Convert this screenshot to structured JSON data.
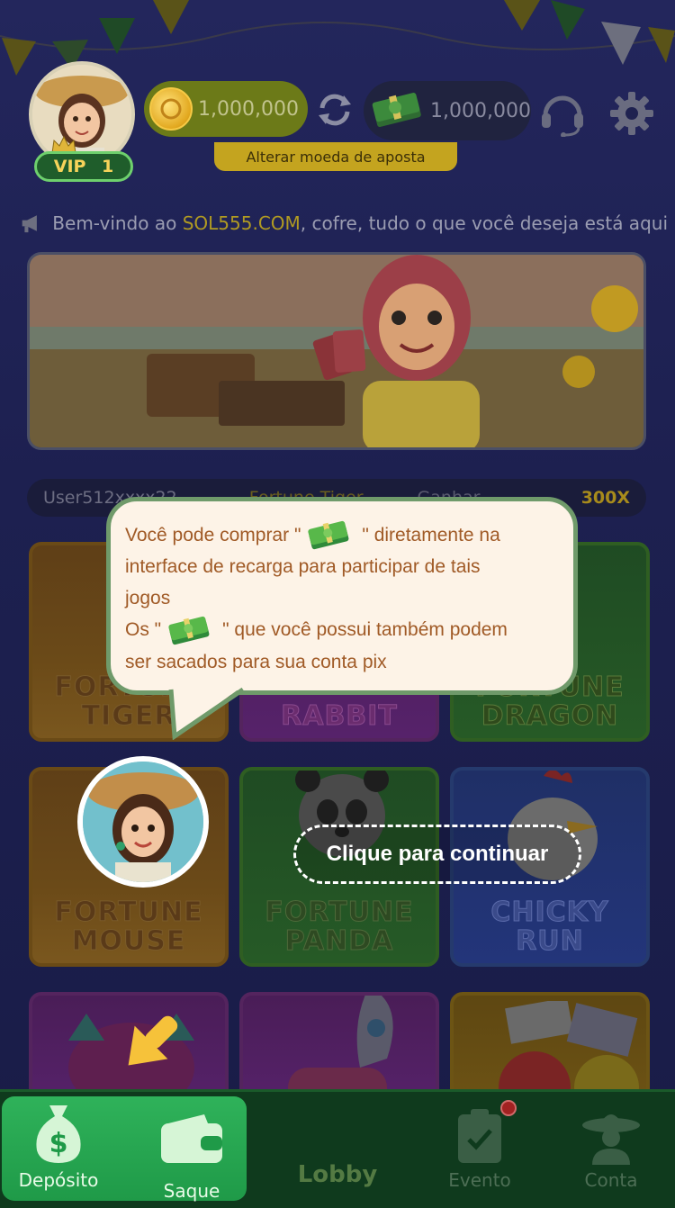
{
  "header": {
    "vip_label": "VIP",
    "vip_level": "1",
    "coin_balance": "1,000,000",
    "cash_balance": "1,000,000",
    "alter_currency_label": "Alterar moeda de aposta"
  },
  "marquee": {
    "prefix": "Bem-vindo ao ",
    "brand": "SOL555.COM",
    "suffix": ", cofre, tudo o que você deseja está aqui"
  },
  "ticker": {
    "user": "User512xxxx22",
    "game": "Fortune Tiger",
    "label": "Ganhar",
    "multiplier": "300X"
  },
  "games": [
    {
      "title_line1": "FORTUNE",
      "title_line2": "TIGER"
    },
    {
      "title_line1": "",
      "title_line2": "RABBIT"
    },
    {
      "title_line1": "FORTUNE",
      "title_line2": "DRAGON"
    },
    {
      "title_line1": "FORTUNE",
      "title_line2": "MOUSE"
    },
    {
      "title_line1": "FORTUNE",
      "title_line2": "PANDA"
    },
    {
      "title_line1": "CHICKY",
      "title_line2": "RUN"
    }
  ],
  "tutorial": {
    "line1_a": "Você pode comprar \"",
    "line1_b": "\" diretamente na",
    "line2": "interface de recarga para participar de tais",
    "line3": "jogos",
    "line4_a": "Os \"",
    "line4_b": "\" que você possui também podem",
    "line5": "ser sacados para sua conta pix",
    "continue_label": "Clique para continuar"
  },
  "nav": {
    "deposit": "Depósito",
    "withdraw": "Saque",
    "lobby": "Lobby",
    "event": "Evento",
    "account": "Conta"
  },
  "colors": {
    "accent_green": "#2fb25a",
    "tooltip_bg": "#fdf3e7",
    "tooltip_text": "#a05a26",
    "brand_gold": "#b09a22"
  }
}
